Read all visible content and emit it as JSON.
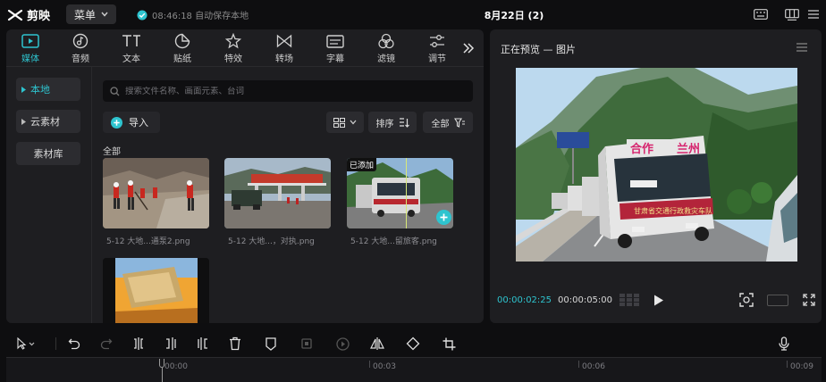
{
  "app": {
    "name": "剪映",
    "menu_label": "菜单",
    "autosave_text": "08:46:18 自动保存本地",
    "project_title": "8月22日 (2)"
  },
  "tabs": [
    {
      "label": "媒体",
      "icon": "media-icon",
      "active": true
    },
    {
      "label": "音频",
      "icon": "audio-icon"
    },
    {
      "label": "文本",
      "icon": "text-icon"
    },
    {
      "label": "贴纸",
      "icon": "sticker-icon"
    },
    {
      "label": "特效",
      "icon": "effects-icon"
    },
    {
      "label": "转场",
      "icon": "transition-icon"
    },
    {
      "label": "字幕",
      "icon": "subtitle-icon"
    },
    {
      "label": "滤镜",
      "icon": "filter-icon"
    },
    {
      "label": "调节",
      "icon": "adjust-icon"
    }
  ],
  "sidebar": {
    "items": [
      {
        "label": "本地",
        "active": true
      },
      {
        "label": "云素材"
      },
      {
        "label": "素材库"
      }
    ]
  },
  "search": {
    "placeholder": "搜索文件名称、画面元素、台词"
  },
  "toolbar": {
    "import_label": "导入",
    "sort_label": "排序",
    "filter_label": "全部"
  },
  "media": {
    "section_label": "全部",
    "added_badge": "已添加",
    "items": [
      {
        "caption": "5-12 大地...通泵2.png"
      },
      {
        "caption": "5-12 大地...，对执.png"
      },
      {
        "caption": "5-12 大地...留旅客.png",
        "added": true
      },
      {
        "caption": ""
      }
    ]
  },
  "preview": {
    "title": "正在预览 — 图片",
    "current_time": "00:00:02:25",
    "total_time": "00:00:05:00",
    "bus_sign_left": "合作",
    "bus_sign_right": "兰州",
    "bus_banner": "甘肃省交通行政救灾车队"
  },
  "timeline": {
    "ruler": [
      "00:00",
      "00:03",
      "00:06",
      "00:09"
    ]
  },
  "colors": {
    "accent": "#2ec4cf",
    "panel": "#1e1e21",
    "background": "#0e0e10"
  }
}
